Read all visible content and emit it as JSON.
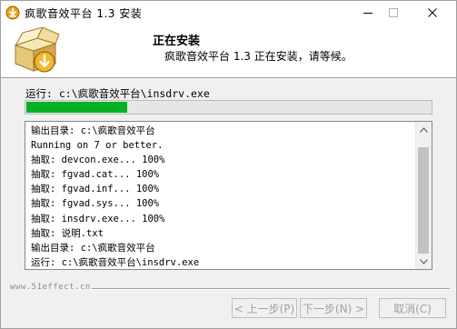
{
  "window": {
    "title": "疯歌音效平台 1.3 安装"
  },
  "header": {
    "heading": "正在安装",
    "subtitle": "疯歌音效平台 1.3 正在安装，请等候。"
  },
  "status": {
    "text": "运行: c:\\疯歌音效平台\\insdrv.exe",
    "progress_fraction": 0.25
  },
  "log": {
    "lines": [
      "输出目录: c:\\疯歌音效平台",
      "Running on 7 or better.",
      "抽取: devcon.exe... 100%",
      "抽取: fgvad.cat... 100%",
      "抽取: fgvad.inf... 100%",
      "抽取: fgvad.sys... 100%",
      "抽取: insdrv.exe... 100%",
      "抽取: 说明.txt",
      "输出目录: c:\\疯歌音效平台",
      "运行: c:\\疯歌音效平台\\insdrv.exe"
    ]
  },
  "footer": {
    "watermark": "www.51effect.cn",
    "back_label": "< 上一步(P)",
    "next_label": "下一步(N) >",
    "cancel_label": "取消(C)"
  },
  "colors": {
    "progress_fill": "#06b025",
    "disabled_text": "#a0a0a0"
  },
  "icons": {
    "app": "installer-app-icon",
    "header": "installer-box-icon",
    "minimize": "minimize-icon",
    "maximize": "maximize-icon",
    "close": "close-icon",
    "scroll_up": "chevron-up-icon",
    "scroll_down": "chevron-down-icon"
  }
}
